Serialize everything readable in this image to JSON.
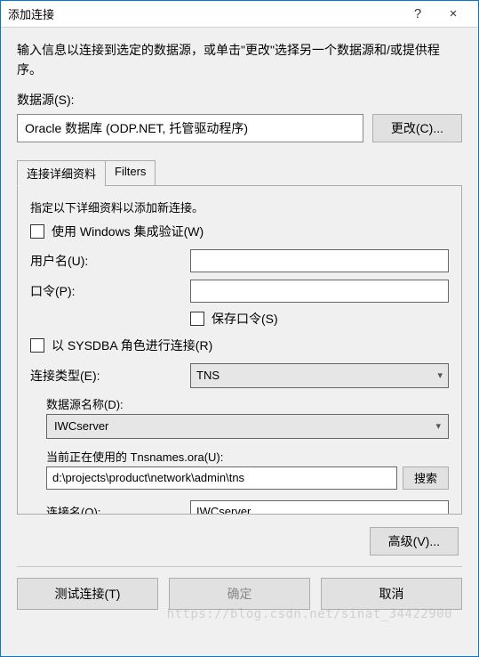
{
  "window": {
    "title": "添加连接",
    "help_symbol": "?",
    "close_symbol": "×"
  },
  "intro": "输入信息以连接到选定的数据源，或单击\"更改\"选择另一个数据源和/或提供程序。",
  "datasource": {
    "label": "数据源(S):",
    "value": "Oracle 数据库 (ODP.NET, 托管驱动程序)",
    "change_btn": "更改(C)..."
  },
  "tabs": {
    "conn_details": "连接详细资料",
    "filters": "Filters"
  },
  "details": {
    "instruction": "指定以下详细资料以添加新连接。",
    "use_windows_auth": "使用 Windows 集成验证(W)",
    "username_label": "用户名(U):",
    "username_value": "",
    "password_label": "口令(P):",
    "password_value": "",
    "save_password": "保存口令(S)",
    "sysdba": "以 SYSDBA 角色进行连接(R)",
    "conn_type_label": "连接类型(E):",
    "conn_type_value": "TNS",
    "ds_name_label": "数据源名称(D):",
    "ds_name_value": "IWCserver",
    "tns_label": "当前正在使用的 Tnsnames.ora(U):",
    "tns_path": "d:\\projects\\product\\network\\admin\\tns",
    "tns_search_btn": "搜索",
    "conn_name_label": "连接名(O):",
    "conn_name_value": "IWCserver"
  },
  "buttons": {
    "advanced": "高级(V)...",
    "test": "测试连接(T)",
    "ok": "确定",
    "cancel": "取消"
  },
  "watermark": "https://blog.csdn.net/sinat_34422900"
}
